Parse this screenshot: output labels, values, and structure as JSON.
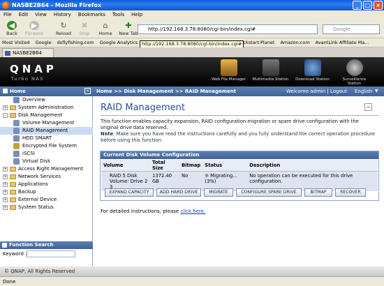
{
  "window": {
    "title": "NASBE2B64 - Mozilla Firefox"
  },
  "menu": [
    "File",
    "Edit",
    "View",
    "History",
    "Bookmarks",
    "Tools",
    "Help"
  ],
  "nav": {
    "back": "Back",
    "forward": "Forward",
    "reload": "Reload",
    "stop": "Stop",
    "home": "Home",
    "new_tab": "New Tab",
    "url": "http://192.168.3.78:8080/cgi-bin/index.cgi#",
    "search_placeholder": "Google"
  },
  "bookmarks": [
    "Most Visited",
    "Google",
    "dsflyfishing.com",
    "Google Analytics",
    "Kickstart Planet",
    "Amazon.com",
    "AvantLink Affiliate Ma..."
  ],
  "tooltip": "http://192.168.3.78:8080/cgi-bin/index.cgi#",
  "tab": {
    "label": "NASBE2B64"
  },
  "brand": {
    "logo": "QNAP",
    "sub": "Turbo NAS"
  },
  "header_icons": [
    "Web File Manager",
    "Multimedia Station",
    "Download Station",
    "Surveillance Station"
  ],
  "crumb": {
    "home": "Home",
    "path": "Home >> Disk Management >> RAID Management",
    "welcome": "Welcome admin | Logout",
    "lang": "English"
  },
  "tree": [
    {
      "label": "Overview",
      "level": 1,
      "toggle": "",
      "icon": "doc"
    },
    {
      "label": "System Administration",
      "level": 0,
      "toggle": "+",
      "icon": "folder"
    },
    {
      "label": "Disk Management",
      "level": 0,
      "toggle": "-",
      "icon": "folder"
    },
    {
      "label": "Volume Management",
      "level": 1,
      "toggle": "",
      "icon": "disk"
    },
    {
      "label": "RAID Management",
      "level": 1,
      "toggle": "",
      "icon": "disk",
      "selected": true
    },
    {
      "label": "HDD SMART",
      "level": 1,
      "toggle": "",
      "icon": "disk"
    },
    {
      "label": "Encrypted File System",
      "level": 1,
      "toggle": "",
      "icon": "lock"
    },
    {
      "label": "iSCSI",
      "level": 1,
      "toggle": "",
      "icon": "disk"
    },
    {
      "label": "Virtual Disk",
      "level": 1,
      "toggle": "",
      "icon": "disk"
    },
    {
      "label": "Access Right Management",
      "level": 0,
      "toggle": "+",
      "icon": "folder"
    },
    {
      "label": "Network Services",
      "level": 0,
      "toggle": "+",
      "icon": "folder"
    },
    {
      "label": "Applications",
      "level": 0,
      "toggle": "+",
      "icon": "folder"
    },
    {
      "label": "Backup",
      "level": 0,
      "toggle": "+",
      "icon": "folder"
    },
    {
      "label": "External Device",
      "level": 0,
      "toggle": "+",
      "icon": "folder"
    },
    {
      "label": "System Status",
      "level": 0,
      "toggle": "+",
      "icon": "folder"
    }
  ],
  "function_search": {
    "title": "Function Search",
    "keyword_label": "Keyword :"
  },
  "main": {
    "title": "RAID Management",
    "desc": "This function enables capacity expansion, RAID configuration migration or spare drive configuration with the original drive data reserved.",
    "note_label": "Note",
    "note": ": Make sure you have read the instructions carefully and you fully understand the correct operation procedure before using this function.",
    "panel_title": "Current Disk Volume Configuration",
    "columns": [
      "Volume",
      "Total Size",
      "Bitmap",
      "Status",
      "Description"
    ],
    "row": {
      "volume": "RAID 5 Disk Volume: Drive 2 3",
      "size": "1372.40 GB",
      "bitmap": "No",
      "status": "Migrating... (3%)",
      "description": "No operation can be executed for this drive configuration."
    },
    "buttons": [
      "EXPAND CAPACITY",
      "ADD HARD DRIVE",
      "MIGRATE",
      "CONFIGURE SPARE DRIVE",
      "BITMAP",
      "RECOVER"
    ],
    "instr_prefix": "For detailed instructions, please ",
    "instr_link": "click here."
  },
  "footer": "© QNAP, All Rights Reserved",
  "status": "Done"
}
